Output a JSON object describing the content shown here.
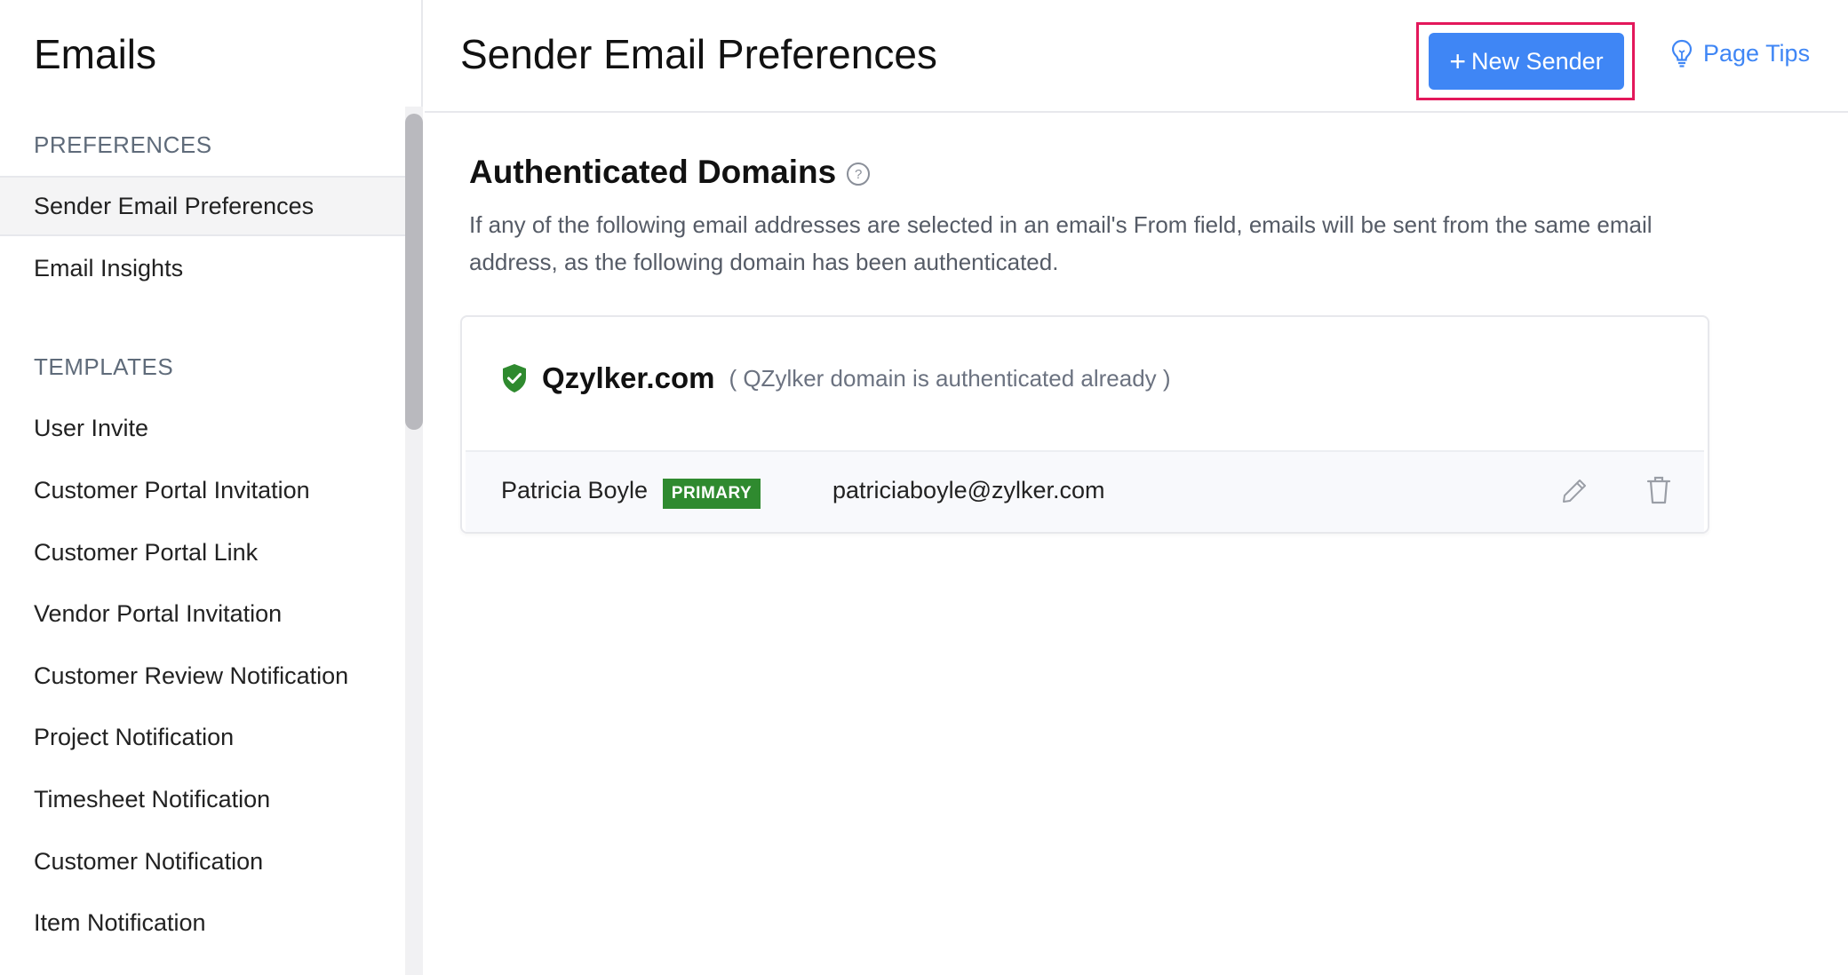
{
  "sidebar": {
    "title": "Emails",
    "sections": [
      {
        "label": "PREFERENCES",
        "items": [
          {
            "label": "Sender Email Preferences",
            "active": true
          },
          {
            "label": "Email Insights",
            "active": false
          }
        ]
      },
      {
        "label": "TEMPLATES",
        "items": [
          {
            "label": "User Invite"
          },
          {
            "label": "Customer Portal Invitation"
          },
          {
            "label": "Customer Portal Link"
          },
          {
            "label": "Vendor Portal Invitation"
          },
          {
            "label": "Customer Review Notification"
          },
          {
            "label": "Project Notification"
          },
          {
            "label": "Timesheet Notification"
          },
          {
            "label": "Customer Notification"
          },
          {
            "label": "Item Notification"
          }
        ]
      }
    ]
  },
  "header": {
    "title": "Sender Email Preferences",
    "new_sender_label": "New Sender",
    "page_tips_label": "Page Tips"
  },
  "main": {
    "section_title": "Authenticated Domains",
    "description": "If any of the following email addresses are selected in an email's From field, emails will be sent from the same email address, as the following domain has been authenticated.",
    "domain": {
      "name": "Qzylker.com",
      "note": "( QZylker domain is authenticated already )",
      "senders": [
        {
          "name": "Patricia Boyle",
          "badge": "PRIMARY",
          "email": "patriciaboyle@zylker.com"
        }
      ]
    }
  },
  "colors": {
    "accent": "#3f86f5",
    "primary_badge": "#2f8a2f",
    "highlight": "#e3185b",
    "verified_shield": "#2f8a2f"
  },
  "icons": [
    "plus-icon",
    "lightbulb-icon",
    "help-circle-icon",
    "verified-shield-icon",
    "pencil-icon",
    "trash-icon"
  ]
}
